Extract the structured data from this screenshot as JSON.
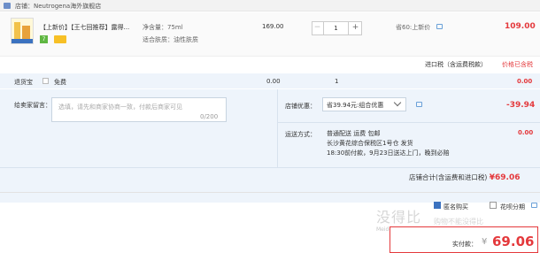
{
  "shop": {
    "label": "店铺：Neutrogena海外旗舰店"
  },
  "product": {
    "title": "【上新价】【王七回推荐】露得...",
    "badge_num": "7",
    "spec_volume": "净含量：75ml",
    "spec_skin": "适合肤质：油性肤质",
    "unit_price": "169.00",
    "quantity": "1",
    "qty_minus": "−",
    "qty_plus": "+",
    "saved": "省60:上新价",
    "subtotal": "109.00",
    "tax_label": "进口税（含运费税款）",
    "tax_value": "价格已含税"
  },
  "delivery": {
    "label": "退货宝",
    "free": "免费",
    "fee": "0.00",
    "qty": "1",
    "subtotal": "0.00"
  },
  "message": {
    "label": "给卖家留言：",
    "placeholder": "选填，请先和商家协商一致，付款后商家可见",
    "count": "0/200"
  },
  "discount": {
    "label": "店铺优惠：",
    "selected": "省39.94元:组合优惠",
    "value": "-39.94"
  },
  "shipping": {
    "label": "运送方式：",
    "line1": "普通配送 运费 包邮",
    "line2": "长沙黄花综合保税区1号仓   发货",
    "line3": "18:30前付款，9月23日送达上门，晚到必赔",
    "value": "0.00"
  },
  "shop_total": {
    "label": "店铺合计(含运费和进口税)",
    "value": "¥69.06"
  },
  "options": {
    "anonymous": "匿名购买",
    "install": "花呗分期"
  },
  "payment": {
    "label": "实付款：",
    "currency": "¥",
    "amount": "69.06"
  },
  "watermark": {
    "main": "没得比",
    "sub": "Meideb.com",
    "side": "购物不能没得比"
  },
  "colors": {
    "accent_red": "#e4393c",
    "row_blue": "#eef4fb",
    "check_blue": "#3b72c0"
  }
}
